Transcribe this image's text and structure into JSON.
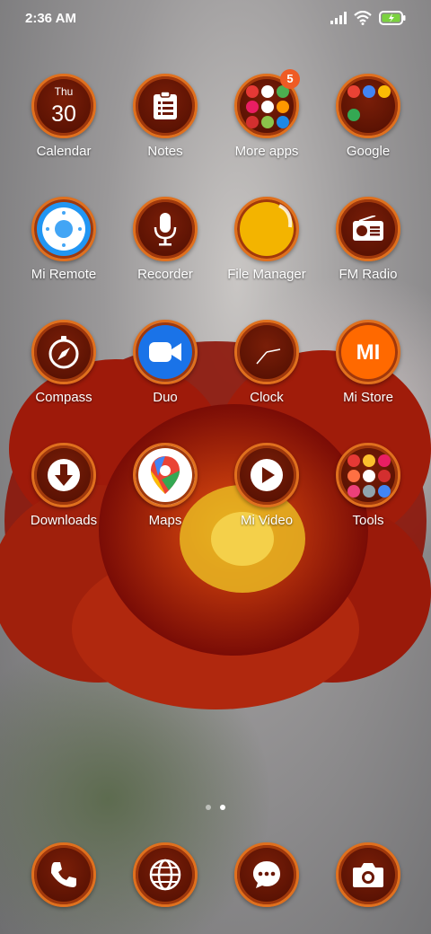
{
  "status_bar": {
    "time": "2:36 AM"
  },
  "apps": [
    {
      "id": "calendar",
      "label": "Calendar",
      "day": "Thu",
      "date": "30"
    },
    {
      "id": "notes",
      "label": "Notes"
    },
    {
      "id": "more-apps",
      "label": "More apps",
      "badge": "5"
    },
    {
      "id": "google",
      "label": "Google"
    },
    {
      "id": "mi-remote",
      "label": "Mi Remote"
    },
    {
      "id": "recorder",
      "label": "Recorder"
    },
    {
      "id": "file-manager",
      "label": "File Manager"
    },
    {
      "id": "fm-radio",
      "label": "FM Radio"
    },
    {
      "id": "compass",
      "label": "Compass"
    },
    {
      "id": "duo",
      "label": "Duo"
    },
    {
      "id": "clock",
      "label": "Clock"
    },
    {
      "id": "mi-store",
      "label": "Mi Store",
      "icon_text": "MI"
    },
    {
      "id": "downloads",
      "label": "Downloads"
    },
    {
      "id": "maps",
      "label": "Maps"
    },
    {
      "id": "mi-video",
      "label": "Mi Video"
    },
    {
      "id": "tools",
      "label": "Tools"
    }
  ],
  "pager": {
    "pages": 2,
    "current": 2
  },
  "dock": [
    {
      "id": "phone",
      "icon": "phone-icon"
    },
    {
      "id": "browser",
      "icon": "globe-icon"
    },
    {
      "id": "messages",
      "icon": "chat-icon"
    },
    {
      "id": "camera",
      "icon": "camera-icon"
    }
  ],
  "colors": {
    "ring": "#e0701e",
    "icon_bg": "#6a1705",
    "badge": "#ef5b24"
  }
}
